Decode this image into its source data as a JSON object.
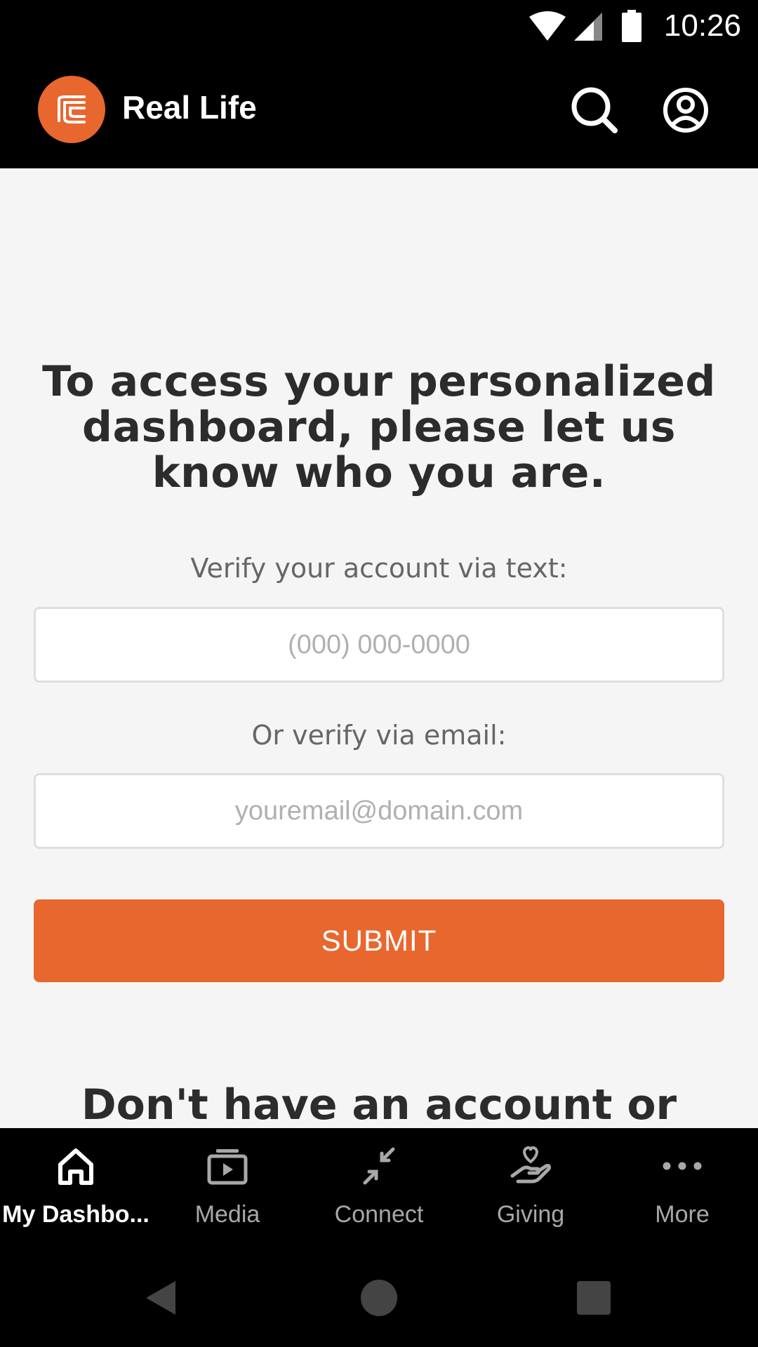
{
  "status_bar": {
    "time": "10:26",
    "icons": [
      "wifi-icon",
      "cell-signal-icon",
      "battery-icon"
    ]
  },
  "app_bar": {
    "title": "Real Life",
    "logo": "real-life-logo",
    "actions": [
      "search-icon",
      "account-icon"
    ]
  },
  "main": {
    "headline": "To access your personalized dashboard, please let us know who you are.",
    "phone_label": "Verify your account via text:",
    "phone_placeholder": "(000) 000-0000",
    "email_label": "Or verify via email:",
    "email_placeholder": "youremail@domain.com",
    "submit_label": "SUBMIT",
    "footer_heading": "Don't have an account or"
  },
  "bottom_nav": {
    "items": [
      {
        "label": "My Dashbo...",
        "icon": "home-icon",
        "active": true
      },
      {
        "label": "Media",
        "icon": "media-play-icon",
        "active": false
      },
      {
        "label": "Connect",
        "icon": "connect-arrows-icon",
        "active": false
      },
      {
        "label": "Giving",
        "icon": "giving-hand-heart-icon",
        "active": false
      },
      {
        "label": "More",
        "icon": "more-dots-icon",
        "active": false
      }
    ]
  },
  "colors": {
    "accent": "#e8672f",
    "bar_background": "#000000",
    "page_background": "#f5f5f5",
    "heading_text": "#2c2c2c",
    "inactive_nav": "#a8a8a8"
  }
}
